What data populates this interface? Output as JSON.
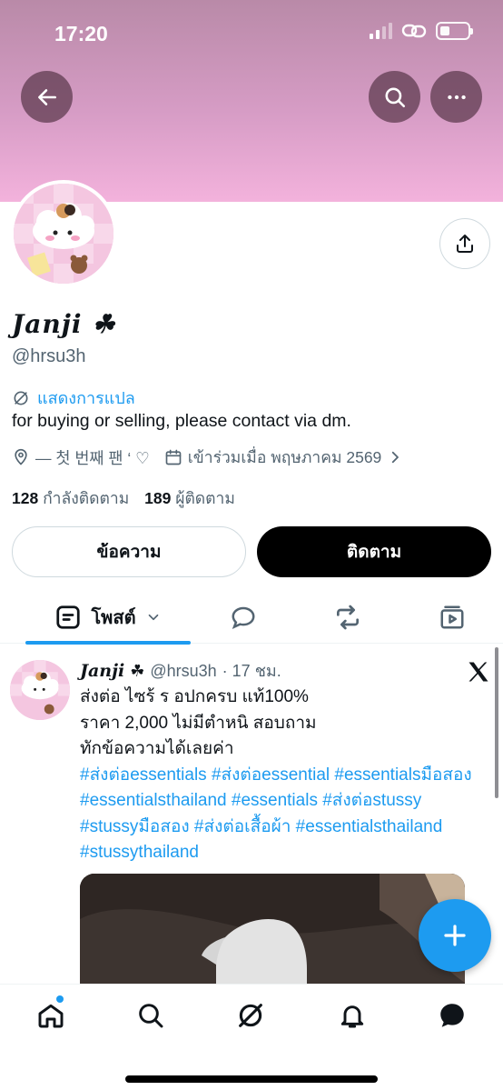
{
  "status_bar": {
    "time": "17:20"
  },
  "profile": {
    "display_name": "Janji ☘︎",
    "display_name_text": "Janji",
    "handle": "@hrsu3h",
    "translate_label": "แสดงการแปล",
    "bio": "for buying or selling, please contact via dm.",
    "location": "— 첫 번째 팬 ‘ ♡",
    "joined": "เข้าร่วมเมื่อ พฤษภาคม 2569",
    "following_count": "128",
    "following_label": "กำลังติดตาม",
    "followers_count": "189",
    "followers_label": "ผู้ติดตาม",
    "message_button": "ข้อความ",
    "follow_button": "ติดตาม"
  },
  "tabs": {
    "posts_label": "โพสต์"
  },
  "post": {
    "author_name": "Janji",
    "author_symbol": "☘︎",
    "author_handle": "@hrsu3h",
    "time": "· 17 ชม.",
    "line1": "ส่งต่อ ไซร้ ร อปกครบ แท้100%",
    "line2": "ราคา 2,000 ไม่มีตำหนิ สอบถาม",
    "line3": "ทักข้อความได้เลยค่า",
    "hashtags": "#ส่งต่อessentials #ส่งต่อessential #essentialsมือสอง #essentialsthailand #essentials #ส่งต่อstussy #stussyมือสอง #ส่งต่อเสื้อผ้า #essentialsthailand #stussythailand"
  },
  "icons": {
    "back": "arrow-left-icon",
    "search": "search-icon",
    "more": "more-horizontal-icon",
    "share": "share-icon",
    "translate": "translate-icon",
    "location": "location-pin-icon",
    "calendar": "calendar-icon",
    "fab": "plus-icon",
    "nav": [
      "home-icon",
      "search-icon",
      "grok-icon",
      "bell-icon",
      "messages-icon"
    ]
  },
  "colors": {
    "accent": "#1d9bf0",
    "text": "#0f1419",
    "muted": "#536471",
    "banner_top": "#b98aa8",
    "banner_bottom": "#f3b2dc"
  }
}
